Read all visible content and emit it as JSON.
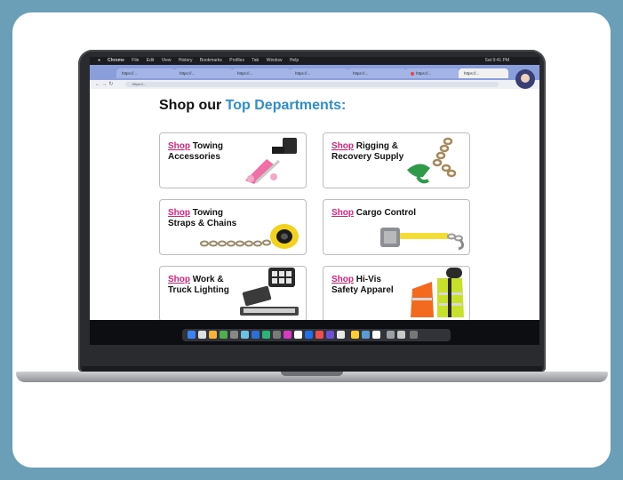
{
  "menubar": {
    "app_name": "Chrome",
    "menus": [
      "File",
      "Edit",
      "View",
      "History",
      "Bookmarks",
      "Profiles",
      "Tab",
      "Window",
      "Help"
    ],
    "clock": "Sat 9:41 PM"
  },
  "browser": {
    "tabs": [
      "https://...",
      "https://...",
      "https://...",
      "https://...",
      "https://...",
      "https://...",
      "https://..."
    ],
    "url": "https://..."
  },
  "page": {
    "heading_prefix": "Shop our",
    "heading_highlight": "Top Departments:",
    "departments": [
      {
        "shop": "Shop",
        "label": " Towing Accessories",
        "icon": "tow-dolly-icon"
      },
      {
        "shop": "Shop",
        "label": " Rigging & Recovery Supply",
        "icon": "chain-hook-icon"
      },
      {
        "shop": "Shop",
        "label": " Towing Straps & Chains",
        "icon": "strap-roll-icon"
      },
      {
        "shop": "Shop",
        "label": " Cargo Control",
        "icon": "ratchet-strap-icon"
      },
      {
        "shop": "Shop",
        "label": " Work & Truck Lighting",
        "icon": "work-light-icon"
      },
      {
        "shop": "Shop",
        "label": " Hi-Vis Safety Apparel",
        "icon": "safety-vest-icon"
      }
    ]
  },
  "colors": {
    "accent_blue": "#2d8fcf",
    "shop_pink": "#e11f7d",
    "backdrop": "#6a9fb7"
  }
}
